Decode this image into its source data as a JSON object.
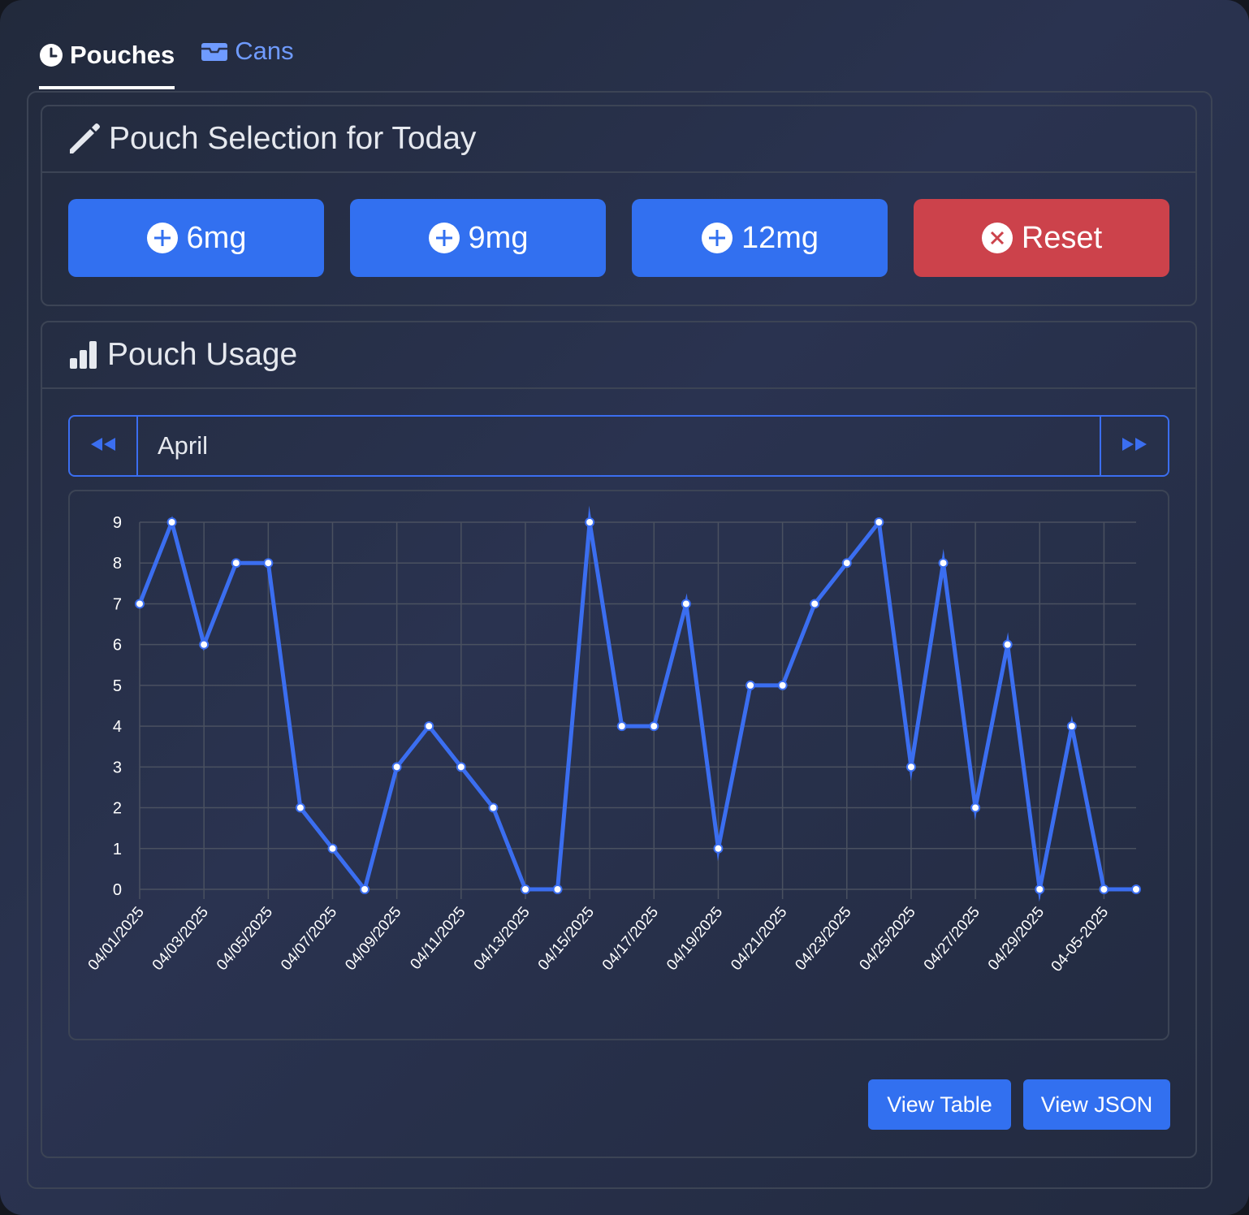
{
  "tabs": [
    {
      "label": "Pouches",
      "icon": "clock-icon",
      "active": true
    },
    {
      "label": "Cans",
      "icon": "inbox-icon",
      "active": false
    }
  ],
  "selection": {
    "title": "Pouch Selection for Today",
    "icon": "pencil-icon",
    "buttons": [
      {
        "label": "6mg",
        "icon": "plus-circle-icon"
      },
      {
        "label": "9mg",
        "icon": "plus-circle-icon"
      },
      {
        "label": "12mg",
        "icon": "plus-circle-icon"
      },
      {
        "label": "Reset",
        "icon": "x-circle-icon"
      }
    ]
  },
  "usage": {
    "title": "Pouch Usage",
    "icon": "bar-chart-icon",
    "month": "April",
    "prev_icon": "rewind-icon",
    "next_icon": "fast-forward-icon",
    "view_table_label": "View Table",
    "view_json_label": "View JSON"
  },
  "colors": {
    "accent": "#3270f0",
    "danger": "#cc424b",
    "line": "#3b6ef0",
    "grid": "#4a5160",
    "text": "#e6e9ef"
  },
  "chart_data": {
    "type": "line",
    "x": [
      "04/01/2025",
      "04/02/2025",
      "04/03/2025",
      "04/04/2025",
      "04/05/2025",
      "04/06/2025",
      "04/07/2025",
      "04/08/2025",
      "04/09/2025",
      "04/10/2025",
      "04/11/2025",
      "04/12/2025",
      "04/13/2025",
      "04/14/2025",
      "04/15/2025",
      "04/16/2025",
      "04/17/2025",
      "04/18/2025",
      "04/19/2025",
      "04/20/2025",
      "04/21/2025",
      "04/22/2025",
      "04/23/2025",
      "04/24/2025",
      "04/25/2025",
      "04/26/2025",
      "04/27/2025",
      "04/28/2025",
      "04/29/2025",
      "04/30/2025",
      "04-05-2025",
      "04-05-2025"
    ],
    "tick_labels": [
      "04/01/2025",
      "04/03/2025",
      "04/05/2025",
      "04/07/2025",
      "04/09/2025",
      "04/11/2025",
      "04/13/2025",
      "04/15/2025",
      "04/17/2025",
      "04/19/2025",
      "04/21/2025",
      "04/23/2025",
      "04/25/2025",
      "04/27/2025",
      "04/29/2025",
      "04-05-2025"
    ],
    "y": [
      7,
      9,
      6,
      8,
      8,
      2,
      1,
      0,
      3,
      4,
      3,
      2,
      0,
      0,
      9,
      4,
      4,
      7,
      1,
      5,
      5,
      7,
      8,
      9,
      3,
      8,
      2,
      6,
      0,
      4,
      0,
      0
    ],
    "yticks": [
      0,
      1,
      2,
      3,
      4,
      5,
      6,
      7,
      8,
      9
    ],
    "ylim": [
      0,
      9
    ],
    "grid": true,
    "legend": "none",
    "title": "",
    "xlabel": "",
    "ylabel": ""
  }
}
